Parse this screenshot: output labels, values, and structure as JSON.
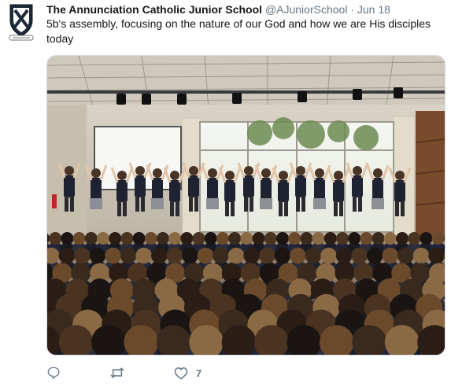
{
  "tweet": {
    "author_name": "The Annunciation Catholic Junior School",
    "handle": "@AJuniorSchool",
    "separator": "·",
    "date": "Jun 18",
    "text": "5b's assembly, focusing on the nature of our God and how we are His disciples today",
    "avatar_motto": "VERITAS"
  },
  "actions": {
    "reply_icon": "reply-icon",
    "retweet_icon": "retweet-icon",
    "like_icon": "heart-icon",
    "like_count": "7"
  },
  "colors": {
    "text_primary": "#14171a",
    "text_secondary": "#657786",
    "border": "#d6dde3"
  }
}
